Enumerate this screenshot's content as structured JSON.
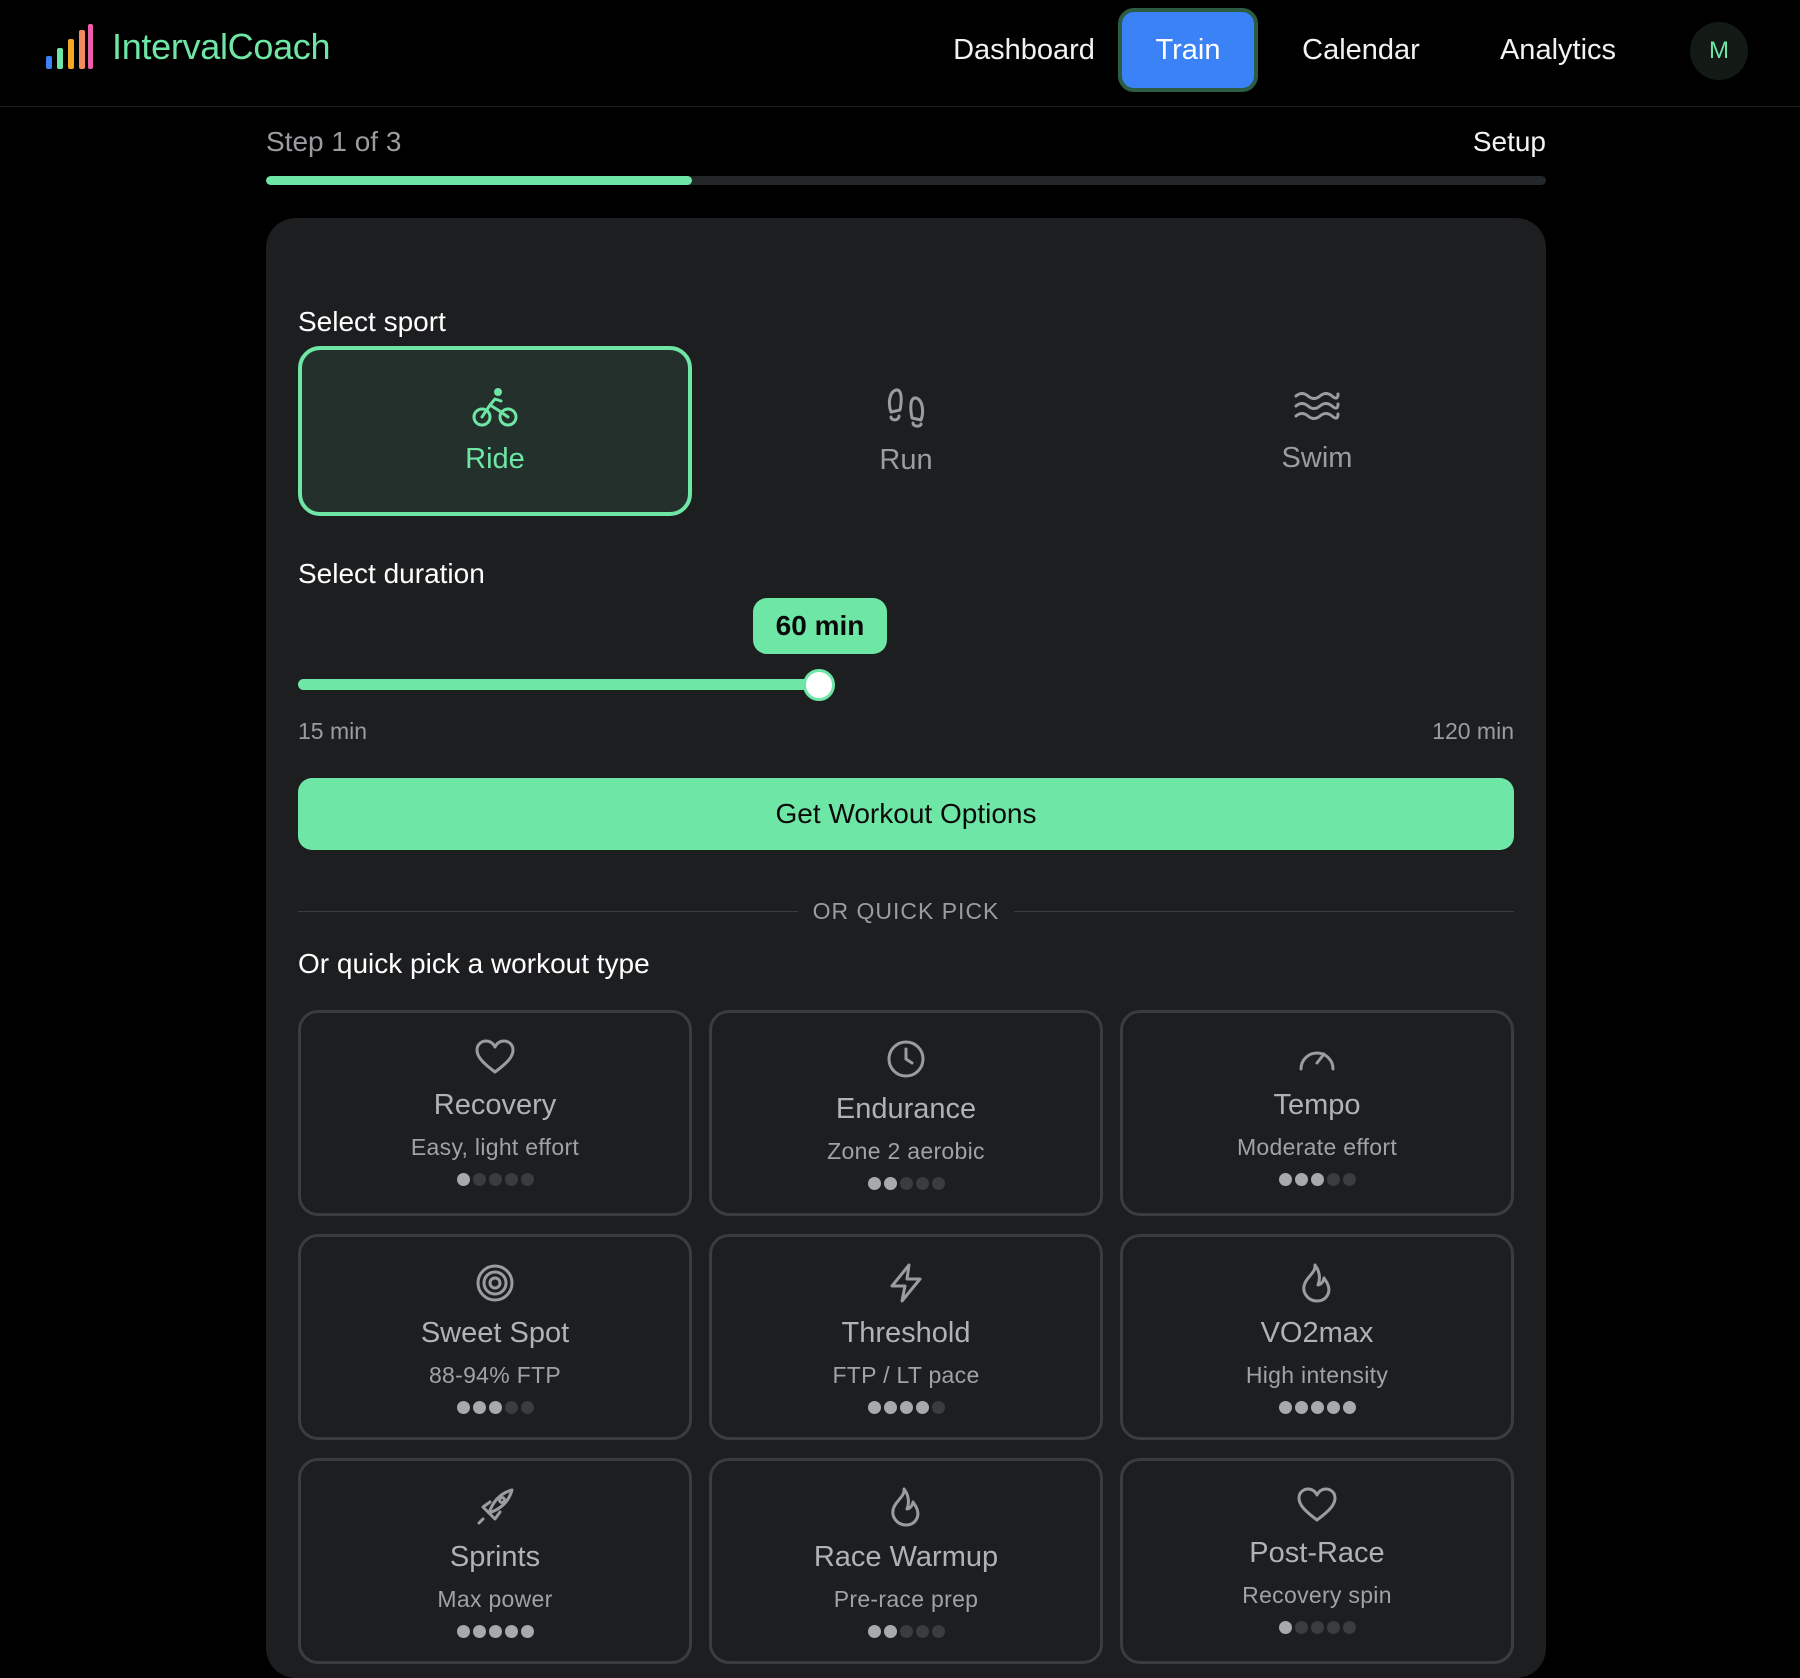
{
  "app": {
    "name": "IntervalCoach",
    "avatar_initial": "M"
  },
  "nav": {
    "items": [
      {
        "id": "dashboard",
        "label": "Dashboard"
      },
      {
        "id": "train",
        "label": "Train",
        "active": true
      },
      {
        "id": "calendar",
        "label": "Calendar"
      },
      {
        "id": "analytics",
        "label": "Analytics"
      }
    ]
  },
  "progress": {
    "step_label": "Step 1 of 3",
    "section_label": "Setup",
    "fraction": 0.333
  },
  "sport": {
    "title": "Select sport",
    "options": [
      {
        "id": "ride",
        "label": "Ride",
        "icon": "bike-icon",
        "selected": true
      },
      {
        "id": "run",
        "label": "Run",
        "icon": "footprints-icon",
        "selected": false
      },
      {
        "id": "swim",
        "label": "Swim",
        "icon": "waves-icon",
        "selected": false
      }
    ]
  },
  "duration": {
    "title": "Select duration",
    "value_label": "60 min",
    "value": 60,
    "min": 15,
    "max": 120,
    "min_label": "15 min",
    "max_label": "120 min"
  },
  "cta": {
    "label": "Get Workout Options"
  },
  "divider": {
    "label": "OR QUICK PICK"
  },
  "quick_pick": {
    "title": "Or quick pick a workout type",
    "workouts": [
      {
        "name": "Recovery",
        "desc": "Easy, light effort",
        "icon": "heart-icon",
        "intensity": 1
      },
      {
        "name": "Endurance",
        "desc": "Zone 2 aerobic",
        "icon": "clock-icon",
        "intensity": 2
      },
      {
        "name": "Tempo",
        "desc": "Moderate effort",
        "icon": "gauge-icon",
        "intensity": 3
      },
      {
        "name": "Sweet Spot",
        "desc": "88-94% FTP",
        "icon": "target-icon",
        "intensity": 3
      },
      {
        "name": "Threshold",
        "desc": "FTP / LT pace",
        "icon": "lightning-icon",
        "intensity": 4
      },
      {
        "name": "VO2max",
        "desc": "High intensity",
        "icon": "flame-icon",
        "intensity": 5
      },
      {
        "name": "Sprints",
        "desc": "Max power",
        "icon": "rocket-icon",
        "intensity": 5
      },
      {
        "name": "Race Warmup",
        "desc": "Pre-race prep",
        "icon": "flame-icon",
        "intensity": 2
      },
      {
        "name": "Post-Race",
        "desc": "Recovery spin",
        "icon": "heart-icon",
        "intensity": 1
      }
    ]
  },
  "colors": {
    "accent": "#6ee7a6",
    "nav_active": "#3b82f6",
    "card_bg": "#1d1e20",
    "page_bg": "#000000"
  }
}
